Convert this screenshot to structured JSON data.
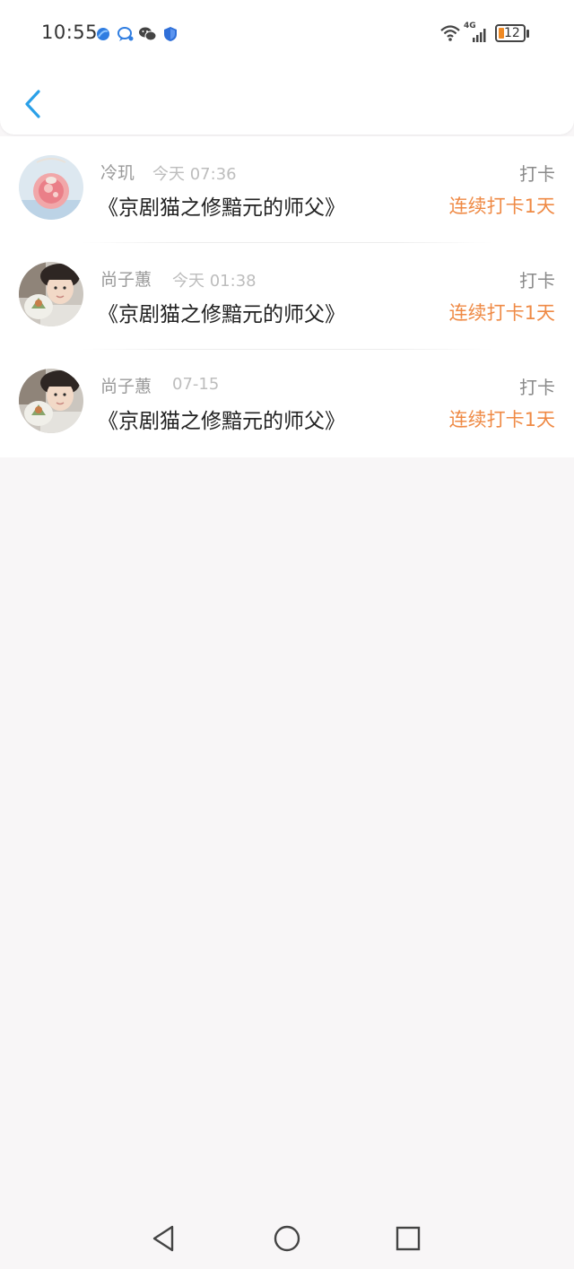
{
  "status_bar": {
    "time": "10:55",
    "notification_icons": [
      "browser-icon",
      "chat-bubble-icon",
      "wechat-icon",
      "shield-icon"
    ],
    "network_label": "4G",
    "battery_level": "12",
    "accent": "#2f7de1",
    "battery_accent": "#f08a24"
  },
  "header": {
    "back_icon": "chevron-left-icon",
    "accent": "#2aa0e8"
  },
  "list": {
    "items": [
      {
        "name": "冷玑",
        "time": "今天 07:36",
        "title": "《京剧猫之修黯元的师父》",
        "tag": "打卡",
        "streak": "连续打卡1天"
      },
      {
        "name": "尚子蕙",
        "time": "今天 01:38",
        "title": "《京剧猫之修黯元的师父》",
        "tag": "打卡",
        "streak": "连续打卡1天"
      },
      {
        "name": "尚子蕙",
        "time": "07-15",
        "title": "《京剧猫之修黯元的师父》",
        "tag": "打卡",
        "streak": "连续打卡1天"
      }
    ]
  },
  "colors": {
    "streak": "#ef8a45",
    "background": "#f8f6f7"
  },
  "nav_bar": {
    "buttons": [
      "back-triangle-icon",
      "home-circle-icon",
      "recents-square-icon"
    ]
  }
}
